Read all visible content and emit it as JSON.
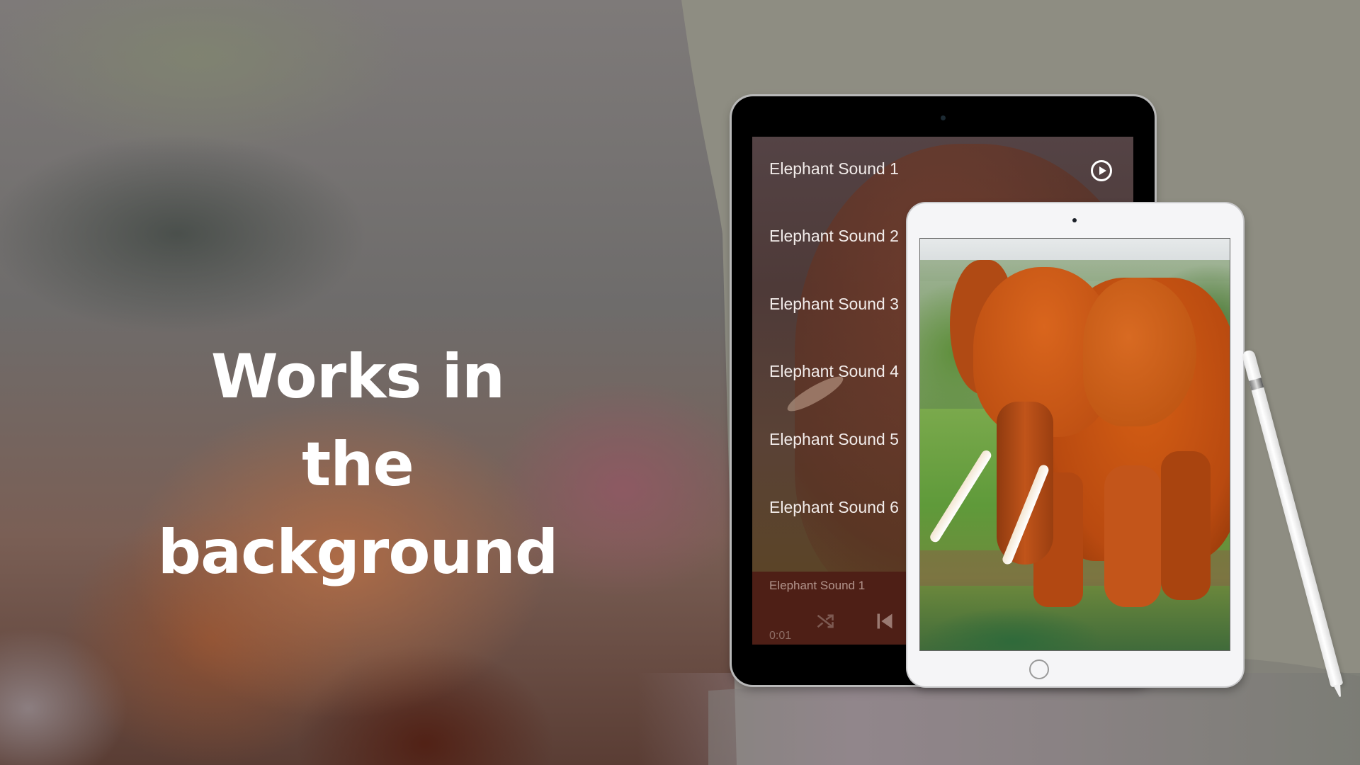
{
  "headline": {
    "line1": "Works in the",
    "line2": "background"
  },
  "app_screen": {
    "sound_list": [
      {
        "label": "Elephant Sound 1",
        "icon": "play-circle-icon"
      },
      {
        "label": "Elephant Sound 2"
      },
      {
        "label": "Elephant Sound 3"
      },
      {
        "label": "Elephant Sound 4"
      },
      {
        "label": "Elephant Sound 5"
      },
      {
        "label": "Elephant Sound 6"
      }
    ],
    "player": {
      "now_playing": "Elephant Sound 1",
      "elapsed_time": "0:01",
      "controls": [
        "shuffle-icon",
        "skip-previous-icon"
      ]
    }
  },
  "colors": {
    "backdrop_right": "#8e8d82",
    "player_bar": "#4e1f16",
    "list_text": "#f2ecea",
    "headline_text": "#ffffff"
  }
}
